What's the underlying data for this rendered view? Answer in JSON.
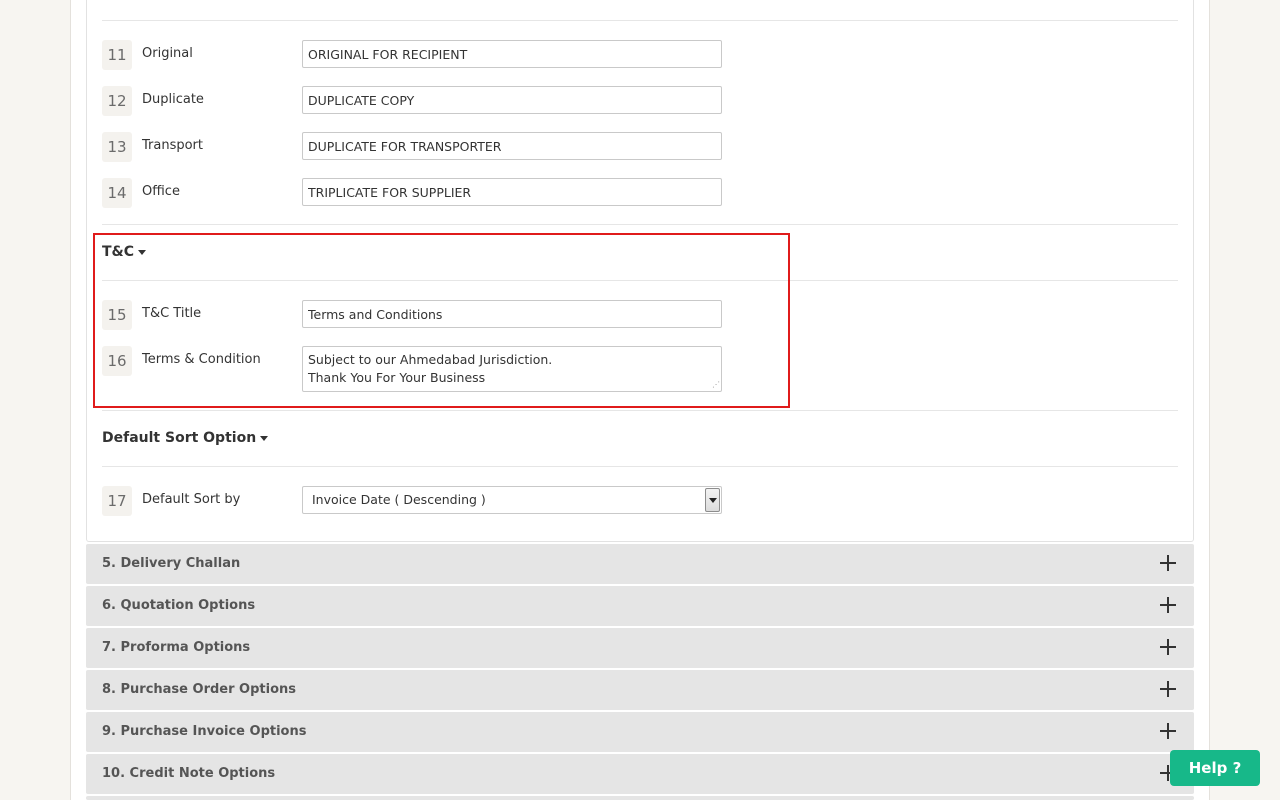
{
  "copy_labels": {
    "rows": [
      {
        "num": "11",
        "label": "Original",
        "value": "ORIGINAL FOR RECIPIENT"
      },
      {
        "num": "12",
        "label": "Duplicate",
        "value": "DUPLICATE COPY"
      },
      {
        "num": "13",
        "label": "Transport",
        "value": "DUPLICATE FOR TRANSPORTER"
      },
      {
        "num": "14",
        "label": "Office",
        "value": "TRIPLICATE FOR SUPPLIER"
      }
    ]
  },
  "tc": {
    "heading": "T&C",
    "title_row": {
      "num": "15",
      "label": "T&C Title",
      "value": "Terms and Conditions"
    },
    "terms_row": {
      "num": "16",
      "label": "Terms & Condition",
      "value": "Subject to our Ahmedabad Jurisdiction.\nThank You For Your Business"
    }
  },
  "sort": {
    "heading": "Default Sort Option",
    "row": {
      "num": "17",
      "label": "Default Sort by",
      "value": "Invoice Date ( Descending )"
    }
  },
  "accordions": [
    {
      "title": "5. Delivery Challan"
    },
    {
      "title": "6. Quotation Options"
    },
    {
      "title": "7. Proforma Options"
    },
    {
      "title": "8. Purchase Order Options"
    },
    {
      "title": "9. Purchase Invoice Options"
    },
    {
      "title": "10. Credit Note Options"
    }
  ],
  "help": {
    "label": "Help ?"
  },
  "colors": {
    "accent_green": "#17b889",
    "highlight_red": "#e01b1b",
    "accordion_bg": "#e5e5e5"
  }
}
